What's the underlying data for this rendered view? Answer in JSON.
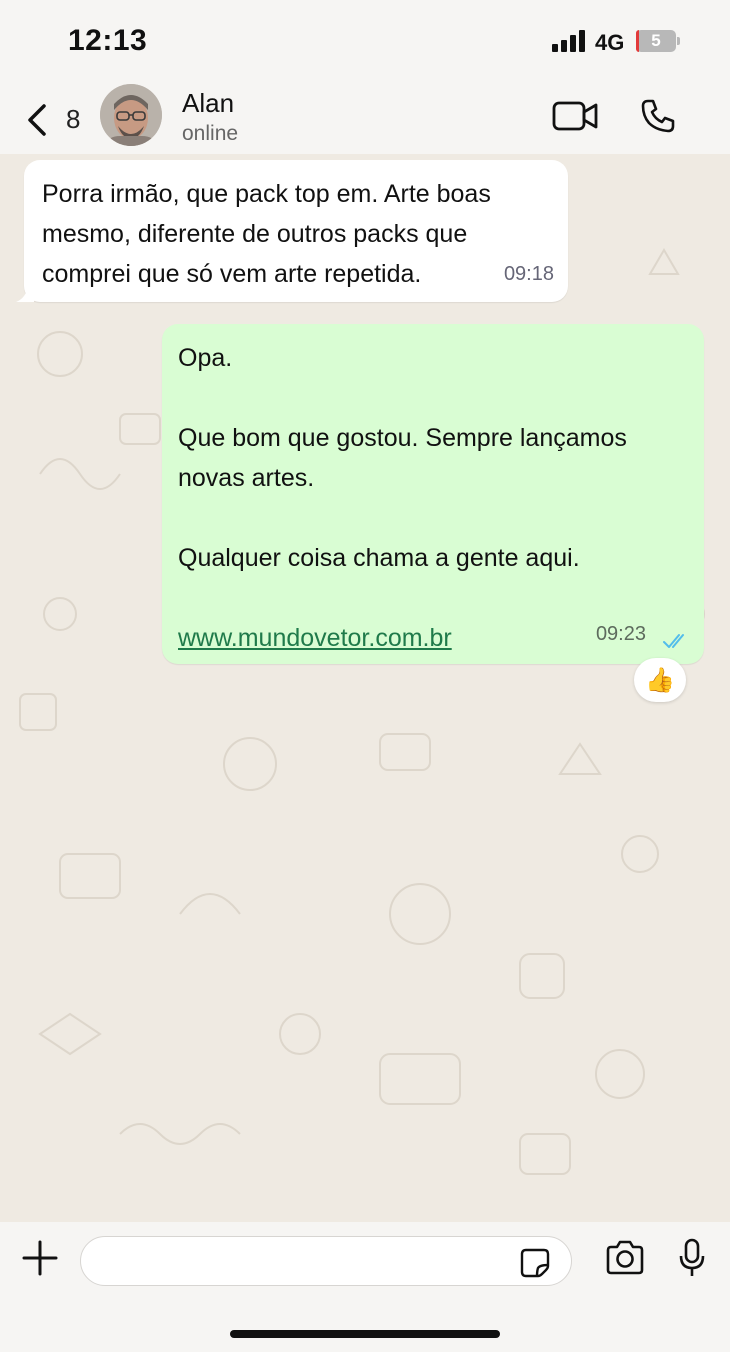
{
  "status_bar": {
    "time": "12:13",
    "network": "4G",
    "battery": "5"
  },
  "header": {
    "unread_count": "8",
    "contact_name": "Alan",
    "contact_status": "online"
  },
  "messages": [
    {
      "direction": "incoming",
      "text": "Porra irmão, que pack top em. Arte boas\nmesmo, diferente de outros packs que\ncomprei que só vem arte repetida.",
      "time": "09:18"
    },
    {
      "direction": "outgoing",
      "text": "Opa.\n\nQue bom que gostou. Sempre lançamos\nnovas artes.\n\nQualquer coisa chama a gente aqui.",
      "link": "www.mundovetor.com.br",
      "time": "09:23",
      "status": "read",
      "reaction": "👍"
    }
  ],
  "composer": {
    "placeholder": ""
  },
  "colors": {
    "outgoing_bubble": "#d9fdd3",
    "incoming_bubble": "#ffffff",
    "read_ticks": "#53bdeb",
    "link": "#1f7a4a"
  }
}
